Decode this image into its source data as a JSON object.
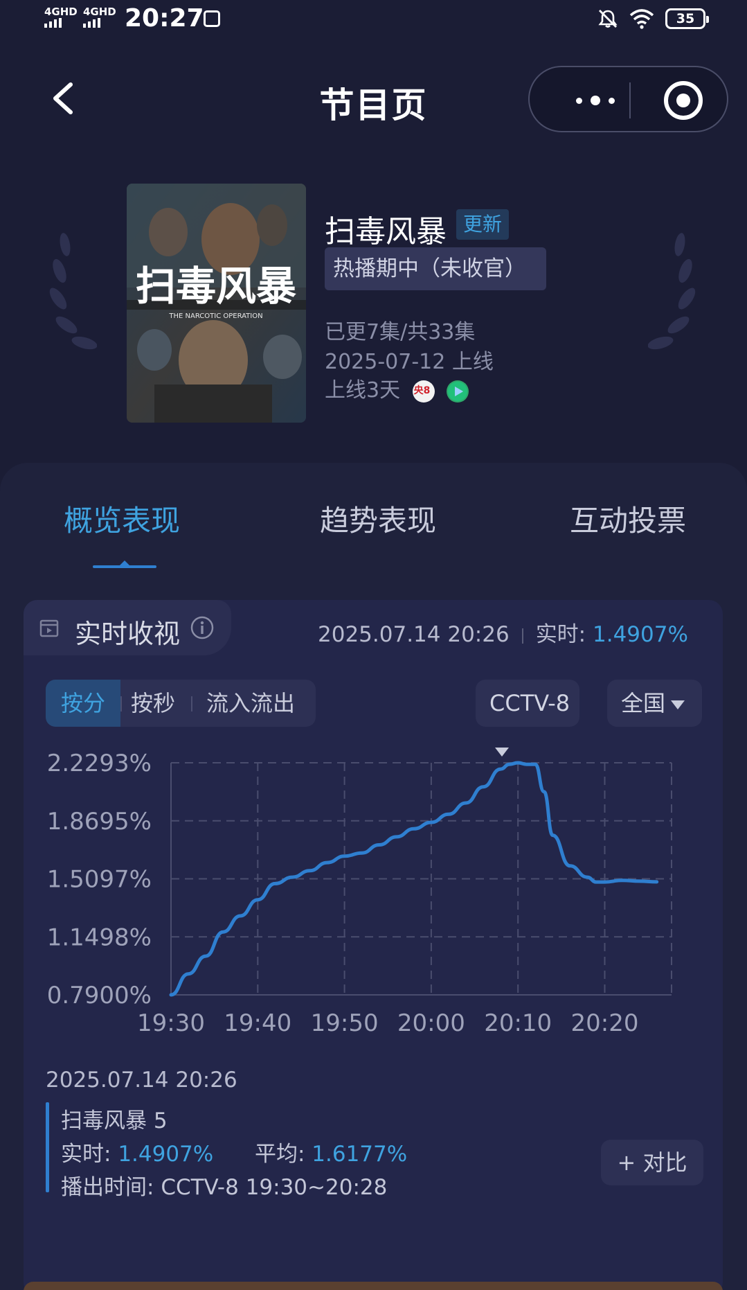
{
  "status_bar": {
    "network1": "4GHD",
    "network2": "4GHD",
    "time": "20:27",
    "battery": "35"
  },
  "nav": {
    "title": "节目页"
  },
  "program": {
    "title": "扫毒风暴",
    "poster_title": "扫毒风暴",
    "poster_subtitle": "THE NARCOTIC OPERATION",
    "update_tag": "更新",
    "status_tag": "热播期中（未收官）",
    "episodes": "已更7集/共33集",
    "release": "2025-07-12 上线",
    "days_online": "上线3天",
    "channel_badge": "央8"
  },
  "tabs": [
    {
      "label": "概览表现",
      "active": true
    },
    {
      "label": "趋势表现",
      "active": false
    },
    {
      "label": "互动投票",
      "active": false
    }
  ],
  "realtime": {
    "title": "实时收视",
    "timestamp": "2025.07.14 20:26",
    "live_label": "实时:",
    "live_value": "1.4907%"
  },
  "segments": [
    {
      "label": "按分",
      "active": true
    },
    {
      "label": "按秒",
      "active": false
    },
    {
      "label": "流入流出",
      "active": false
    }
  ],
  "dropdowns": {
    "channel": "CCTV-8",
    "region": "全国"
  },
  "colors": {
    "accent": "#3fa3e0",
    "line": "#2f7fd0",
    "background": "#1b1d35",
    "card": "#23264a"
  },
  "chart_data": {
    "type": "line",
    "y_tick_labels": [
      "2.2293%",
      "1.8695%",
      "1.5097%",
      "1.1498%",
      "0.7900%"
    ],
    "x_tick_labels": [
      "19:30",
      "19:40",
      "19:50",
      "20:00",
      "20:10",
      "20:20"
    ],
    "ylim": [
      0.79,
      2.2293
    ],
    "xlim": [
      "19:30",
      "20:26"
    ],
    "grid": true,
    "series": [
      {
        "name": "扫毒风暴 5",
        "x": [
          "19:30",
          "19:32",
          "19:34",
          "19:36",
          "19:38",
          "19:40",
          "19:42",
          "19:44",
          "19:46",
          "19:48",
          "19:50",
          "19:52",
          "19:54",
          "19:56",
          "19:58",
          "20:00",
          "20:02",
          "20:04",
          "20:06",
          "20:08",
          "20:09",
          "20:10",
          "20:11",
          "20:12",
          "20:13",
          "20:14",
          "20:16",
          "20:18",
          "20:19",
          "20:20",
          "20:22",
          "20:24",
          "20:26"
        ],
        "y": [
          0.79,
          0.92,
          1.03,
          1.18,
          1.28,
          1.38,
          1.48,
          1.52,
          1.56,
          1.61,
          1.65,
          1.67,
          1.72,
          1.77,
          1.82,
          1.86,
          1.91,
          1.98,
          2.08,
          2.19,
          2.22,
          2.2293,
          2.22,
          2.22,
          2.05,
          1.78,
          1.59,
          1.52,
          1.49,
          1.49,
          1.5,
          1.495,
          1.4907
        ]
      }
    ]
  },
  "footer": {
    "timestamp": "2025.07.14 20:26",
    "program_line": "扫毒风暴 5",
    "live_label": "实时:",
    "live_value": "1.4907%",
    "avg_label": "平均:",
    "avg_value": "1.6177%",
    "airtime_label": "播出时间:",
    "airtime_value": "CCTV-8 19:30~20:28",
    "compare_button": "+ 对比"
  }
}
